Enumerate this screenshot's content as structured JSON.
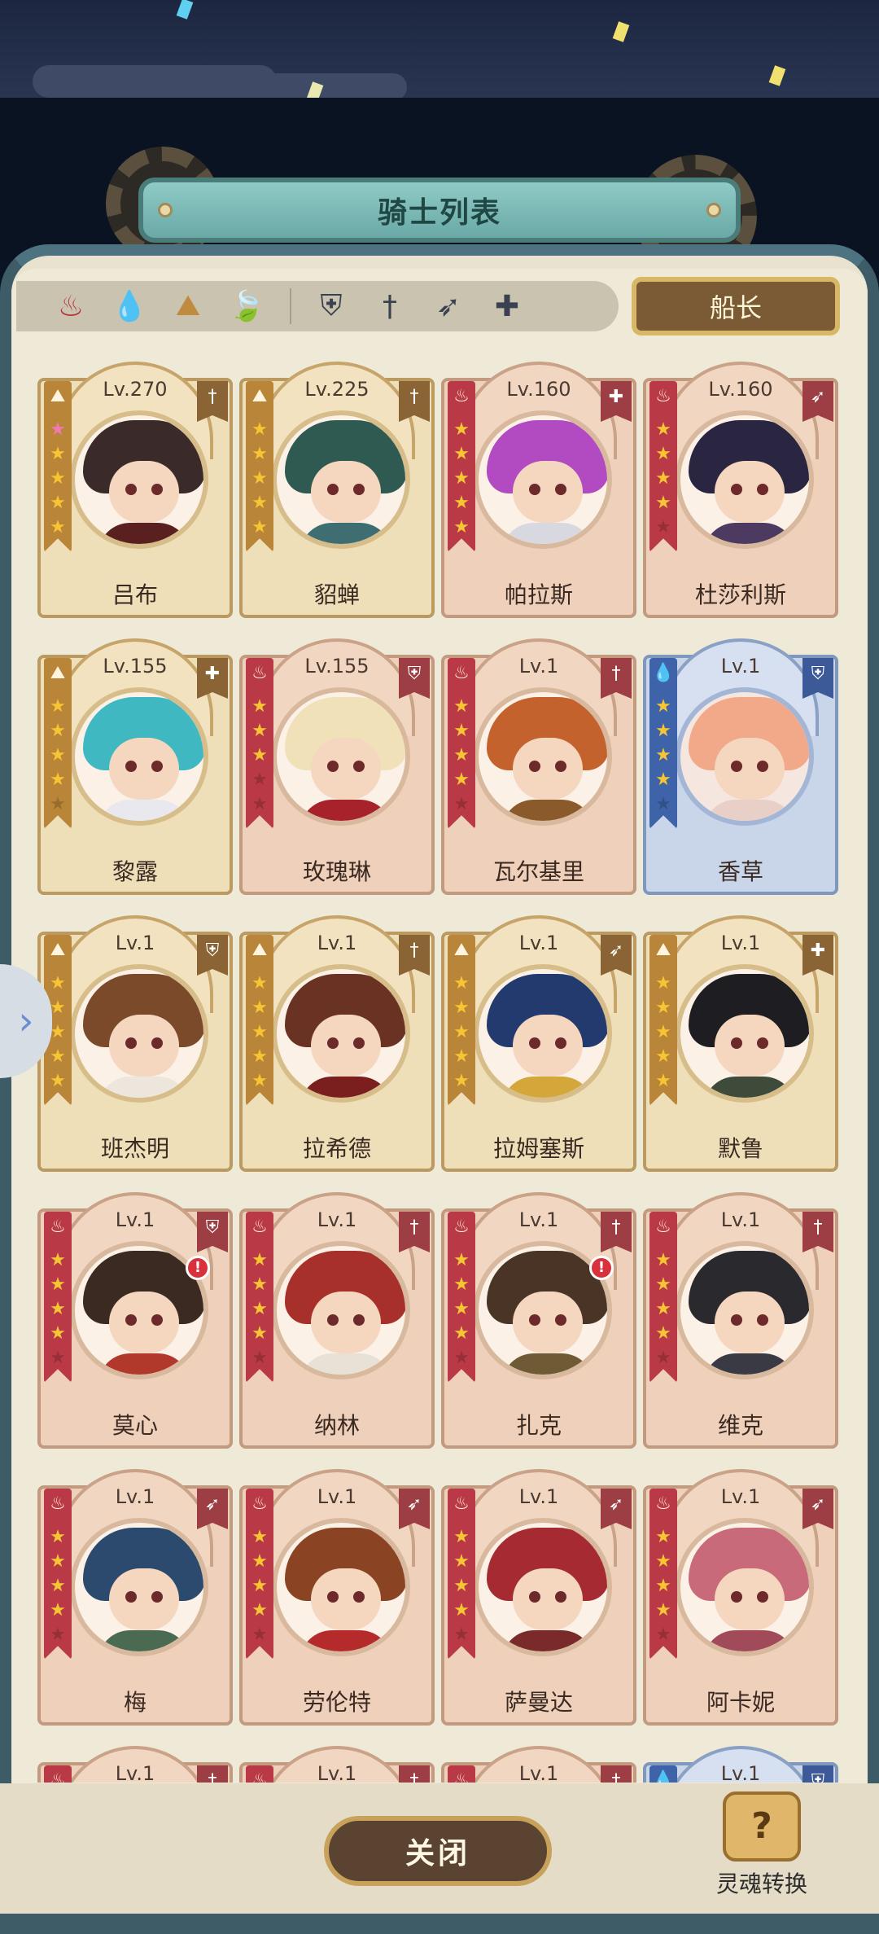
{
  "title": "骑士列表",
  "filters": {
    "elements": [
      {
        "icon": "fire-element-icon",
        "glyph": "♨"
      },
      {
        "icon": "water-element-icon",
        "glyph": "💧"
      },
      {
        "icon": "earth-element-icon",
        "glyph": "⛰"
      },
      {
        "icon": "wind-element-icon",
        "glyph": "🍃"
      }
    ],
    "roles": [
      {
        "icon": "shield-role-icon",
        "glyph": "⛨"
      },
      {
        "icon": "sword-role-icon",
        "glyph": "†"
      },
      {
        "icon": "bow-role-icon",
        "glyph": "➶"
      },
      {
        "icon": "healer-role-icon",
        "glyph": "✚"
      }
    ],
    "captain_label": "船长"
  },
  "heroes": [
    {
      "name": "吕布",
      "level": "Lv.270",
      "theme": "gold",
      "element": "earth",
      "role": "sword",
      "stars": 5,
      "pink": true,
      "hair": "#3a2a2a",
      "body": "#5a2020",
      "alert": false
    },
    {
      "name": "貂蝉",
      "level": "Lv.225",
      "theme": "gold",
      "element": "earth",
      "role": "sword",
      "stars": 5,
      "pink": false,
      "hair": "#2f5a52",
      "body": "#3e6e72",
      "alert": false
    },
    {
      "name": "帕拉斯",
      "level": "Lv.160",
      "theme": "red",
      "element": "fire",
      "role": "healer",
      "stars": 5,
      "pink": false,
      "hair": "#b24bc2",
      "body": "#d8d8e0",
      "alert": false
    },
    {
      "name": "杜莎利斯",
      "level": "Lv.160",
      "theme": "red",
      "element": "fire",
      "role": "bow",
      "stars": 4,
      "pink": false,
      "hair": "#2a2540",
      "body": "#4c3a60",
      "alert": false
    },
    {
      "name": "黎露",
      "level": "Lv.155",
      "theme": "gold",
      "element": "earth",
      "role": "healer",
      "stars": 4,
      "pink": false,
      "hair": "#3fb8c2",
      "body": "#e8e8ee",
      "alert": false
    },
    {
      "name": "玫瑰琳",
      "level": "Lv.155",
      "theme": "red",
      "element": "fire",
      "role": "shield",
      "stars": 3,
      "pink": false,
      "hair": "#f1e1b8",
      "body": "#a8222c",
      "alert": false
    },
    {
      "name": "瓦尔基里",
      "level": "Lv.1",
      "theme": "red",
      "element": "fire",
      "role": "sword",
      "stars": 4,
      "pink": false,
      "hair": "#c4622e",
      "body": "#8a5a2a",
      "alert": false
    },
    {
      "name": "香草",
      "level": "Lv.1",
      "theme": "blue",
      "element": "water",
      "role": "shield",
      "stars": 4,
      "pink": false,
      "hair": "#f1a98a",
      "body": "#e8d0c8",
      "alert": false
    },
    {
      "name": "班杰明",
      "level": "Lv.1",
      "theme": "gold",
      "element": "earth",
      "role": "shield",
      "stars": 5,
      "pink": false,
      "hair": "#7a4a2a",
      "body": "#ece6dc",
      "alert": false
    },
    {
      "name": "拉希德",
      "level": "Lv.1",
      "theme": "gold",
      "element": "earth",
      "role": "sword",
      "stars": 5,
      "pink": false,
      "hair": "#6a3222",
      "body": "#7a1e1e",
      "alert": false
    },
    {
      "name": "拉姆塞斯",
      "level": "Lv.1",
      "theme": "gold",
      "element": "earth",
      "role": "bow",
      "stars": 5,
      "pink": false,
      "hair": "#233a6e",
      "body": "#d4a73a",
      "alert": false
    },
    {
      "name": "默鲁",
      "level": "Lv.1",
      "theme": "gold",
      "element": "earth",
      "role": "healer",
      "stars": 5,
      "pink": false,
      "hair": "#1e1e22",
      "body": "#3e4a3a",
      "alert": false
    },
    {
      "name": "莫心",
      "level": "Lv.1",
      "theme": "red",
      "element": "fire",
      "role": "shield",
      "stars": 4,
      "pink": false,
      "hair": "#3a2a22",
      "body": "#b0392c",
      "alert": true
    },
    {
      "name": "纳林",
      "level": "Lv.1",
      "theme": "red",
      "element": "fire",
      "role": "sword",
      "stars": 4,
      "pink": false,
      "hair": "#a8302a",
      "body": "#e8e2d6",
      "alert": false
    },
    {
      "name": "扎克",
      "level": "Lv.1",
      "theme": "red",
      "element": "fire",
      "role": "sword",
      "stars": 4,
      "pink": false,
      "hair": "#4a3426",
      "body": "#6e5a34",
      "alert": true
    },
    {
      "name": "维克",
      "level": "Lv.1",
      "theme": "red",
      "element": "fire",
      "role": "sword",
      "stars": 4,
      "pink": false,
      "hair": "#2a2a2e",
      "body": "#3a3a44",
      "alert": false
    },
    {
      "name": "梅",
      "level": "Lv.1",
      "theme": "red",
      "element": "fire",
      "role": "bow",
      "stars": 4,
      "pink": false,
      "hair": "#2c4a6e",
      "body": "#4a6a52",
      "alert": false
    },
    {
      "name": "劳伦特",
      "level": "Lv.1",
      "theme": "red",
      "element": "fire",
      "role": "bow",
      "stars": 4,
      "pink": false,
      "hair": "#8a4424",
      "body": "#b52a2a",
      "alert": false
    },
    {
      "name": "萨曼达",
      "level": "Lv.1",
      "theme": "red",
      "element": "fire",
      "role": "bow",
      "stars": 4,
      "pink": false,
      "hair": "#a52a32",
      "body": "#7a2a2a",
      "alert": false
    },
    {
      "name": "阿卡妮",
      "level": "Lv.1",
      "theme": "red",
      "element": "fire",
      "role": "bow",
      "stars": 4,
      "pink": false,
      "hair": "#c96a7a",
      "body": "#a04a5a",
      "alert": false
    },
    {
      "name": "",
      "level": "Lv.1",
      "theme": "red",
      "element": "fire",
      "role": "sword",
      "stars": 4,
      "pink": false,
      "hair": "#8a3a30",
      "body": "#8a3a30",
      "alert": false
    },
    {
      "name": "",
      "level": "Lv.1",
      "theme": "red",
      "element": "fire",
      "role": "sword",
      "stars": 4,
      "pink": false,
      "hair": "#8a3a30",
      "body": "#8a3a30",
      "alert": false
    },
    {
      "name": "",
      "level": "Lv.1",
      "theme": "red",
      "element": "fire",
      "role": "sword",
      "stars": 4,
      "pink": false,
      "hair": "#8a3a30",
      "body": "#8a3a30",
      "alert": false
    },
    {
      "name": "",
      "level": "Lv.1",
      "theme": "blue",
      "element": "water",
      "role": "shield",
      "stars": 4,
      "pink": false,
      "hair": "#8a3a30",
      "body": "#8a3a30",
      "alert": false
    }
  ],
  "glyphs": {
    "fire": "♨",
    "water": "💧",
    "earth": "⛰",
    "sword": "†",
    "shield": "⛨",
    "bow": "➶",
    "healer": "✚",
    "star": "★",
    "alert": "!"
  },
  "close_label": "关闭",
  "soul_label": "灵魂转换",
  "soul_icon_glyph": "?",
  "side_tab_glyph": "›"
}
